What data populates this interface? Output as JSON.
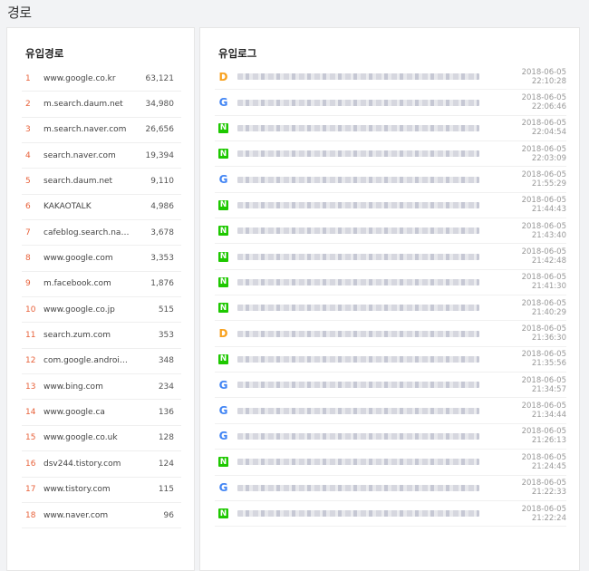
{
  "page": {
    "title": "경로"
  },
  "referrers": {
    "title": "유입경로",
    "items": [
      {
        "rank": "1",
        "name": "www.google.co.kr",
        "count": "63,121"
      },
      {
        "rank": "2",
        "name": "m.search.daum.net",
        "count": "34,980"
      },
      {
        "rank": "3",
        "name": "m.search.naver.com",
        "count": "26,656"
      },
      {
        "rank": "4",
        "name": "search.naver.com",
        "count": "19,394"
      },
      {
        "rank": "5",
        "name": "search.daum.net",
        "count": "9,110"
      },
      {
        "rank": "6",
        "name": "KAKAOTALK",
        "count": "4,986"
      },
      {
        "rank": "7",
        "name": "cafeblog.search.nave…",
        "count": "3,678"
      },
      {
        "rank": "8",
        "name": "www.google.com",
        "count": "3,353"
      },
      {
        "rank": "9",
        "name": "m.facebook.com",
        "count": "1,876"
      },
      {
        "rank": "10",
        "name": "www.google.co.jp",
        "count": "515"
      },
      {
        "rank": "11",
        "name": "search.zum.com",
        "count": "353"
      },
      {
        "rank": "12",
        "name": "com.google.android.…",
        "count": "348"
      },
      {
        "rank": "13",
        "name": "www.bing.com",
        "count": "234"
      },
      {
        "rank": "14",
        "name": "www.google.ca",
        "count": "136"
      },
      {
        "rank": "15",
        "name": "www.google.co.uk",
        "count": "128"
      },
      {
        "rank": "16",
        "name": "dsv244.tistory.com",
        "count": "124"
      },
      {
        "rank": "17",
        "name": "www.tistory.com",
        "count": "115"
      },
      {
        "rank": "18",
        "name": "www.naver.com",
        "count": "96"
      }
    ]
  },
  "logs": {
    "title": "유입로그",
    "items": [
      {
        "source": "daum",
        "time": "2018-06-05 22:10:28"
      },
      {
        "source": "google",
        "time": "2018-06-05 22:06:46"
      },
      {
        "source": "naver",
        "time": "2018-06-05 22:04:54"
      },
      {
        "source": "naver",
        "time": "2018-06-05 22:03:09"
      },
      {
        "source": "google",
        "time": "2018-06-05 21:55:29"
      },
      {
        "source": "naver",
        "time": "2018-06-05 21:44:43"
      },
      {
        "source": "naver",
        "time": "2018-06-05 21:43:40"
      },
      {
        "source": "naver",
        "time": "2018-06-05 21:42:48"
      },
      {
        "source": "naver",
        "time": "2018-06-05 21:41:30"
      },
      {
        "source": "naver",
        "time": "2018-06-05 21:40:29"
      },
      {
        "source": "daum",
        "time": "2018-06-05 21:36:30"
      },
      {
        "source": "naver",
        "time": "2018-06-05 21:35:56"
      },
      {
        "source": "google",
        "time": "2018-06-05 21:34:57"
      },
      {
        "source": "google",
        "time": "2018-06-05 21:34:44"
      },
      {
        "source": "google",
        "time": "2018-06-05 21:26:13"
      },
      {
        "source": "naver",
        "time": "2018-06-05 21:24:45"
      },
      {
        "source": "google",
        "time": "2018-06-05 21:22:33"
      },
      {
        "source": "naver",
        "time": "2018-06-05 21:22:24"
      }
    ]
  },
  "icons": {
    "naver": "naver-icon",
    "google": "google-icon",
    "daum": "daum-icon"
  },
  "colors": {
    "rank": "#e8613a",
    "naver": "#1ec800",
    "google": "#4285f4",
    "daum": "#f8a11e"
  }
}
